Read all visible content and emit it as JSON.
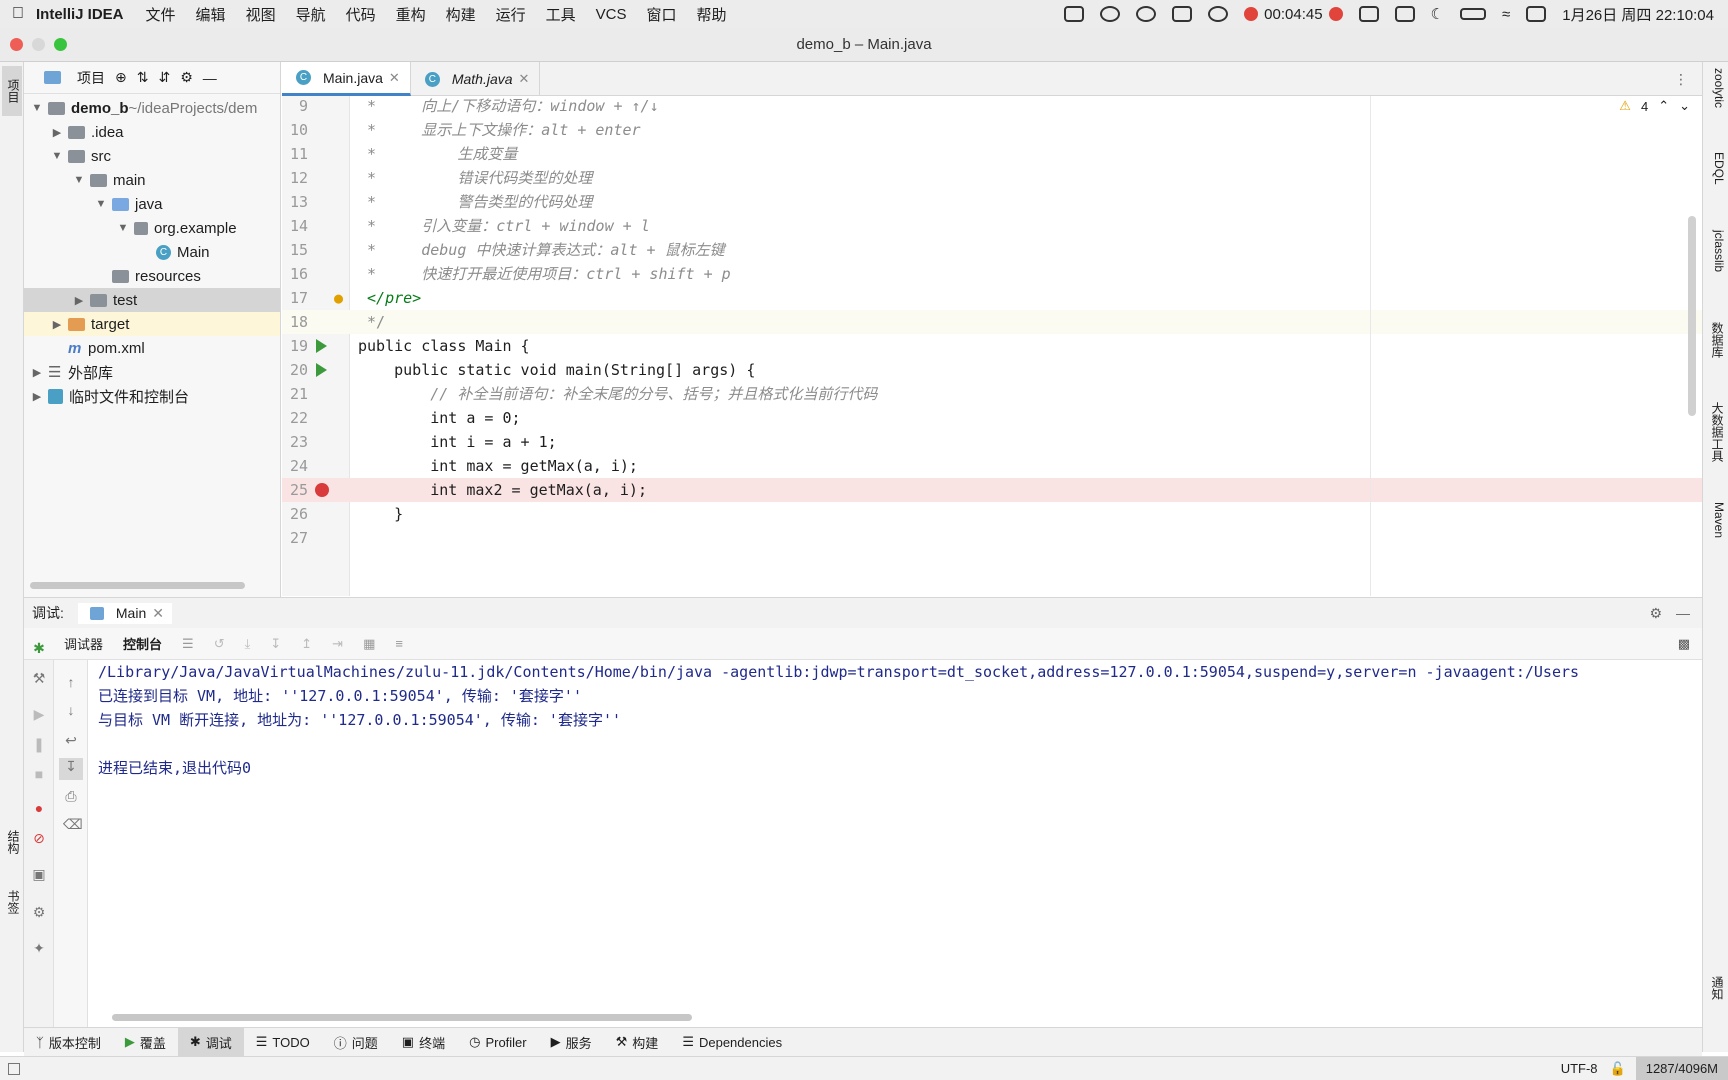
{
  "menubar": {
    "app": "IntelliJ IDEA",
    "items": [
      "文件",
      "编辑",
      "视图",
      "导航",
      "代码",
      "重构",
      "构建",
      "运行",
      "工具",
      "VCS",
      "窗口",
      "帮助"
    ],
    "recording": "00:04:45",
    "datetime": "1月26日 周四 22:10:04"
  },
  "window": {
    "title": "demo_b – Main.java"
  },
  "project": {
    "label": "项目",
    "tree": [
      {
        "text": "demo_b",
        "extra": " ~/ideaProjects/dem",
        "kind": "module"
      },
      {
        "text": ".idea",
        "kind": "folder"
      },
      {
        "text": "src",
        "kind": "folder"
      },
      {
        "text": "main",
        "kind": "folder"
      },
      {
        "text": "java",
        "kind": "folder-blue"
      },
      {
        "text": "org.example",
        "kind": "package"
      },
      {
        "text": "Main",
        "kind": "class"
      },
      {
        "text": "resources",
        "kind": "folder"
      },
      {
        "text": "test",
        "kind": "folder"
      },
      {
        "text": "target",
        "kind": "folder-orange"
      },
      {
        "text": "pom.xml",
        "kind": "maven"
      },
      {
        "text": "外部库",
        "kind": "lib"
      },
      {
        "text": "临时文件和控制台",
        "kind": "scratch"
      }
    ]
  },
  "tabs": [
    {
      "label": "Main.java"
    },
    {
      "label": "Math.java"
    }
  ],
  "editor": {
    "warnings": "4",
    "lines": [
      {
        "n": "9",
        "t": " *     向上/下移动语句：window + ↑/↓"
      },
      {
        "n": "10",
        "t": " *     显示上下文操作：alt + enter"
      },
      {
        "n": "11",
        "t": " *         生成变量"
      },
      {
        "n": "12",
        "t": " *         错误代码类型的处理"
      },
      {
        "n": "13",
        "t": " *         警告类型的代码处理"
      },
      {
        "n": "14",
        "t": " *     引入变量：ctrl + window + l"
      },
      {
        "n": "15",
        "t": " *     debug 中快速计算表达式：alt + 鼠标左键"
      },
      {
        "n": "16",
        "t": " *     快速打开最近使用项目：ctrl + shift + p"
      },
      {
        "n": "17",
        "t": " </pre>"
      },
      {
        "n": "18",
        "t": " */"
      },
      {
        "n": "19",
        "t": "public class Main {"
      },
      {
        "n": "20",
        "t": "    public static void main(String[] args) {"
      },
      {
        "n": "21",
        "t": "        // 补全当前语句：补全末尾的分号、括号；并且格式化当前行代码"
      },
      {
        "n": "22",
        "t": "        int a = 0;"
      },
      {
        "n": "23",
        "t": "        int i = a + 1;"
      },
      {
        "n": "24",
        "t": "        int max = getMax(a, i);"
      },
      {
        "n": "25",
        "t": "        int max2 = getMax(a, i);"
      },
      {
        "n": "26",
        "t": "    }"
      },
      {
        "n": "27",
        "t": ""
      }
    ]
  },
  "debug": {
    "label": "调试:",
    "session": "Main",
    "tab_debugger": "调试器",
    "tab_console": "控制台",
    "console": [
      "/Library/Java/JavaVirtualMachines/zulu-11.jdk/Contents/Home/bin/java -agentlib:jdwp=transport=dt_socket,address=127.0.0.1:59054,suspend=y,server=n -javaagent:/Users",
      "已连接到目标 VM, 地址: ''127.0.0.1:59054', 传输: '套接字''",
      "与目标 VM 断开连接, 地址为: ''127.0.0.1:59054', 传输: '套接字''",
      "",
      "进程已结束,退出代码0"
    ]
  },
  "bottombar": [
    "版本控制",
    "覆盖",
    "调试",
    "TODO",
    "问题",
    "终端",
    "Profiler",
    "服务",
    "构建",
    "Dependencies"
  ],
  "rightstrip": [
    "zoolytic",
    "EDQL",
    "jclasslib",
    "数据库",
    "大数据工具",
    "Maven",
    "通知"
  ],
  "leftstrip": [
    "项目",
    "结构",
    "书签"
  ],
  "status": {
    "encoding": "UTF-8",
    "memory": "1287/4096M"
  }
}
